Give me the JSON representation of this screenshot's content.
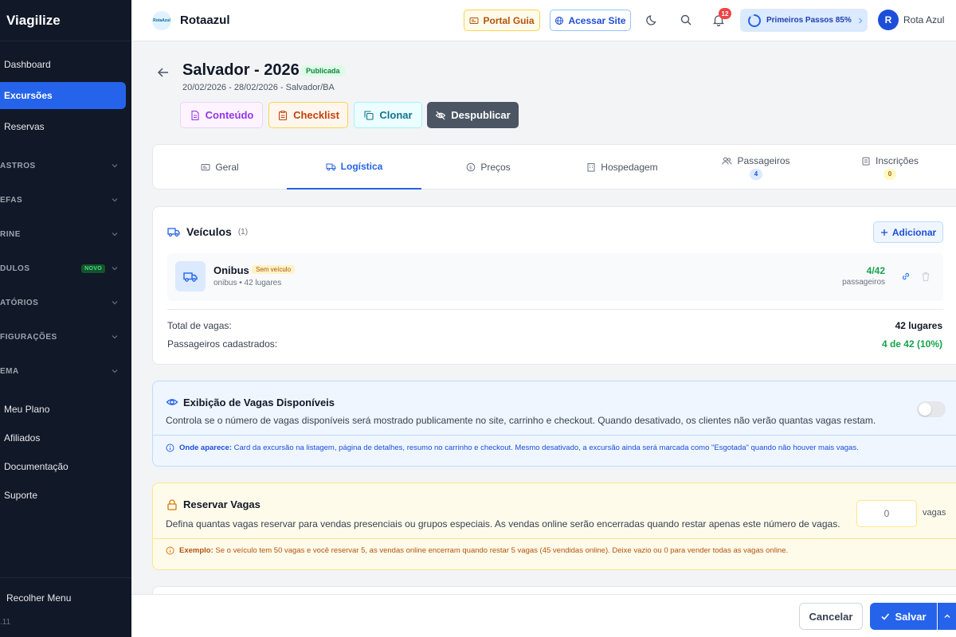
{
  "app": {
    "brand": "Viagilize",
    "version": ".11",
    "collapse_label": "Recolher Menu"
  },
  "sidebar": {
    "items": [
      {
        "label": "Dashboard",
        "active": false
      },
      {
        "label": "Excursões",
        "active": true
      },
      {
        "label": "Reservas",
        "active": false
      }
    ],
    "sections": [
      {
        "label": "ASTROS"
      },
      {
        "label": "EFAS"
      },
      {
        "label": "RINE"
      },
      {
        "label": "DULOS",
        "badge": "NOVO"
      },
      {
        "label": "ATÓRIOS"
      },
      {
        "label": "FIGURAÇÕES"
      },
      {
        "label": "EMA"
      }
    ],
    "links": [
      {
        "label": "Meu Plano"
      },
      {
        "label": "Afiliados"
      },
      {
        "label": "Documentação"
      },
      {
        "label": "Suporte"
      }
    ]
  },
  "topbar": {
    "company": "Rotaazul",
    "logo_text": "RotaAzul",
    "portal_label": "Portal Guia",
    "site_label": "Acessar Site",
    "notifications": "12",
    "progress_label": "Primeiros Passos 85%",
    "progress_value": 0.85,
    "user_initial": "R",
    "user_name": "Rota Azul"
  },
  "header": {
    "title": "Salvador - 2026",
    "status": "Publicada",
    "subtitle": "20/02/2026 - 28/02/2026 - Salvador/BA",
    "actions": {
      "content": "Conteúdo",
      "checklist": "Checklist",
      "clone": "Clonar",
      "unpublish": "Despublicar"
    }
  },
  "tabs": [
    {
      "label": "Geral",
      "icon": "id-card-icon"
    },
    {
      "label": "Logística",
      "icon": "truck-icon",
      "active": true
    },
    {
      "label": "Preços",
      "icon": "dollar-icon"
    },
    {
      "label": "Hospedagem",
      "icon": "building-icon"
    },
    {
      "label": "Passageiros",
      "icon": "users-icon",
      "count": "4"
    },
    {
      "label": "Inscrições",
      "icon": "clipboard-icon",
      "count": "0"
    }
  ],
  "vehicles": {
    "title": "Veículos",
    "count": "(1)",
    "add_label": "Adicionar",
    "item": {
      "name": "Onibus",
      "badge": "Sem veículo",
      "type": "onibus",
      "capacity": "• 42 lugares",
      "occupancy": "4/42",
      "occupancy_label": "passageiros"
    },
    "summary": [
      {
        "label": "Total de vagas:",
        "value": "42 lugares",
        "color": "#111827"
      },
      {
        "label": "Passageiros cadastrados:",
        "value": "4 de 42 (10%)",
        "color": "#16a34a"
      }
    ]
  },
  "availability": {
    "title": "Exibição de Vagas Disponíveis",
    "description": "Controla se o número de vagas disponíveis será mostrado publicamente no site, carrinho e checkout. Quando desativado, os clientes não verão quantas vagas restam.",
    "note_label": "Onde aparece:",
    "note_text": "Card da excursão na listagem, página de detalhes, resumo no carrinho e checkout. Mesmo desativado, a excursão ainda será marcada como \"Esgotada\" quando não houver mais vagas.",
    "enabled": false
  },
  "reserve": {
    "title": "Reservar Vagas",
    "description": "Defina quantas vagas reservar para vendas presenciais ou grupos especiais. As vendas online serão encerradas quando restar apenas este número de vagas.",
    "note_label": "Exemplo:",
    "note_text": "Se o veículo tem 50 vagas e você reservar 5, as vendas online encerram quando restar 5 vagas (45 vendidas online). Deixe vazio ou 0 para vender todas as vagas online.",
    "placeholder": "0",
    "unit": "vagas"
  },
  "footer": {
    "cancel": "Cancelar",
    "save": "Salvar"
  },
  "colors": {
    "accent": "#2563eb",
    "success": "#16a34a",
    "sidebar": "#111827"
  }
}
